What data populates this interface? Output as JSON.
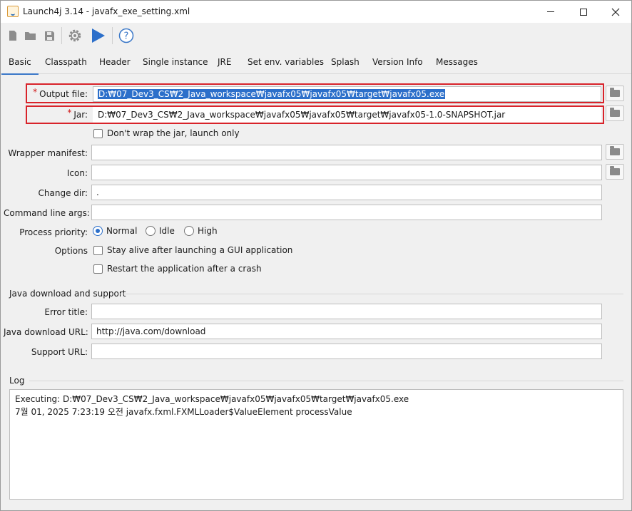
{
  "window": {
    "title": "Launch4j 3.14 - javafx_exe_setting.xml",
    "icons": [
      "app-icon",
      "minimize-icon",
      "maximize-icon",
      "close-icon"
    ]
  },
  "toolbar": {
    "icons": [
      "new-file-icon",
      "open-folder-icon",
      "save-icon",
      "gear-icon",
      "play-icon",
      "help-icon"
    ],
    "accent": "#2c6fca"
  },
  "tabs": [
    "Basic",
    "Classpath",
    "Header",
    "Single instance",
    "JRE",
    "Set env. variables",
    "Splash",
    "Version Info",
    "Messages"
  ],
  "basic": {
    "output_file": {
      "label": "Output file:",
      "value": "D:₩07_Dev3_CS₩2_Java_workspace₩javafx05₩javafx05₩target₩javafx05.exe"
    },
    "jar": {
      "label": "Jar:",
      "value": "D:₩07_Dev3_CS₩2_Java_workspace₩javafx05₩javafx05₩target₩javafx05-1.0-SNAPSHOT.jar"
    },
    "dont_wrap_label": "Don't wrap the jar, launch only",
    "wrapper_manifest_label": "Wrapper manifest:",
    "wrapper_manifest_value": "",
    "icon_label": "Icon:",
    "icon_value": "",
    "change_dir_label": "Change dir:",
    "change_dir_value": ".",
    "cmd_args_label": "Command line args:",
    "cmd_args_value": "",
    "process_priority_label": "Process priority:",
    "priority_options": [
      "Normal",
      "Idle",
      "High"
    ],
    "priority_selected": "Normal",
    "options_label": "Options",
    "stay_alive_label": "Stay alive after launching a GUI application",
    "restart_label": "Restart the application after a crash"
  },
  "java_download": {
    "section_title": "Java download and support",
    "error_title_label": "Error title:",
    "error_title_value": "",
    "download_url_label": "Java download URL:",
    "download_url_value": "http://java.com/download",
    "support_url_label": "Support URL:",
    "support_url_value": ""
  },
  "log": {
    "section_title": "Log",
    "lines": [
      "Executing: D:₩07_Dev3_CS₩2_Java_workspace₩javafx05₩javafx05₩target₩javafx05.exe",
      "7월 01, 2025 7:23:19 오전 javafx.fxml.FXMLLoader$ValueElement processValue"
    ]
  },
  "colors": {
    "highlight_box": "#d8232a",
    "required_star": "#d01818",
    "selection": "#2c6fca"
  },
  "required_marker": "*"
}
